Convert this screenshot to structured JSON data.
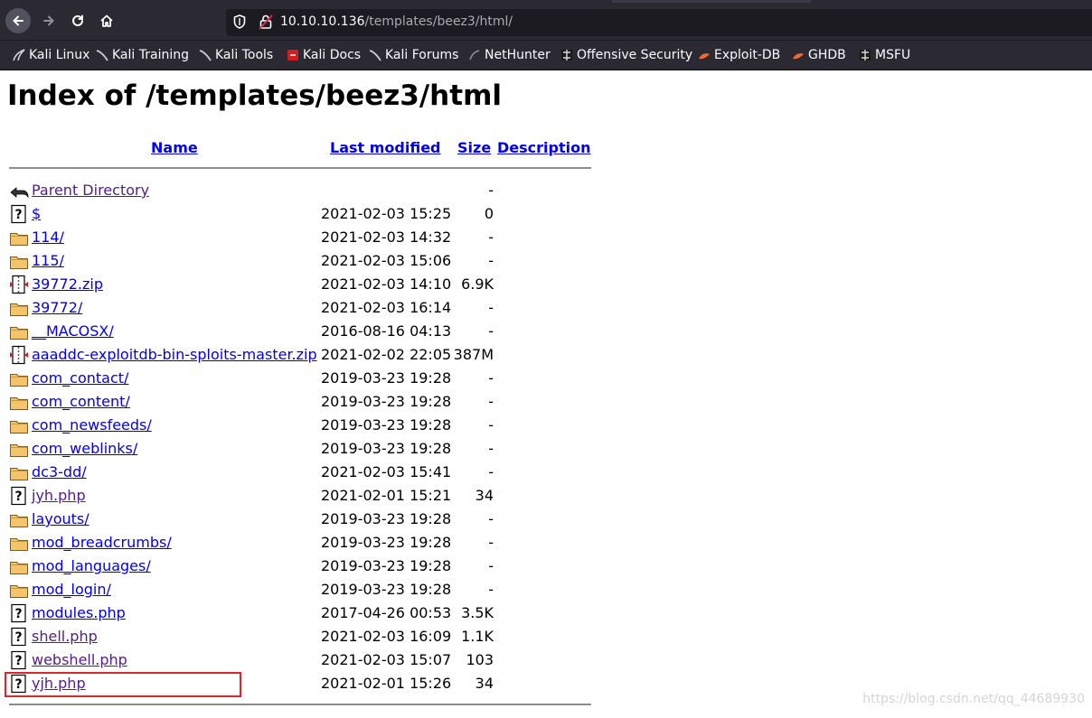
{
  "browser": {
    "url_host": "10.10.10.136",
    "url_path": "/templates/beez3/html/",
    "bookmarks": [
      {
        "label": "Kali Linux",
        "icon": "kali-dragon-icon"
      },
      {
        "label": "Kali Training",
        "icon": "kali-dragon-icon"
      },
      {
        "label": "Kali Tools",
        "icon": "kali-dragon-icon"
      },
      {
        "label": "Kali Docs",
        "icon": "kali-docs-icon"
      },
      {
        "label": "Kali Forums",
        "icon": "kali-dragon-icon"
      },
      {
        "label": "NetHunter",
        "icon": "nethunter-icon"
      },
      {
        "label": "Offensive Security",
        "icon": "offsec-icon"
      },
      {
        "label": "Exploit-DB",
        "icon": "exploitdb-icon"
      },
      {
        "label": "GHDB",
        "icon": "exploitdb-icon"
      },
      {
        "label": "MSFU",
        "icon": "offsec-icon"
      }
    ]
  },
  "page": {
    "title": "Index of /templates/beez3/html",
    "columns": {
      "name": "Name",
      "last_modified": "Last modified",
      "size": "Size",
      "description": "Description"
    },
    "entries": [
      {
        "name": "Parent Directory",
        "date": "",
        "size": "-",
        "icon": "parent-directory-icon",
        "visited": true
      },
      {
        "name": "$",
        "date": "2021-02-03 15:25",
        "size": "0",
        "icon": "unknown-file-icon",
        "visited": false
      },
      {
        "name": "114/",
        "date": "2021-02-03 14:32",
        "size": "-",
        "icon": "folder-icon",
        "visited": false
      },
      {
        "name": "115/",
        "date": "2021-02-03 15:06",
        "size": "-",
        "icon": "folder-icon",
        "visited": false
      },
      {
        "name": "39772.zip",
        "date": "2021-02-03 14:10",
        "size": "6.9K",
        "icon": "archive-icon",
        "visited": false
      },
      {
        "name": "39772/",
        "date": "2021-02-03 16:14",
        "size": "-",
        "icon": "folder-icon",
        "visited": false
      },
      {
        "name": "__MACOSX/",
        "date": "2016-08-16 04:13",
        "size": "-",
        "icon": "folder-icon",
        "visited": false
      },
      {
        "name": "aaaddc-exploitdb-bin-sploits-master.zip",
        "date": "2021-02-02 22:05",
        "size": "387M",
        "icon": "archive-icon",
        "visited": false
      },
      {
        "name": "com_contact/",
        "date": "2019-03-23 19:28",
        "size": "-",
        "icon": "folder-icon",
        "visited": false
      },
      {
        "name": "com_content/",
        "date": "2019-03-23 19:28",
        "size": "-",
        "icon": "folder-icon",
        "visited": false
      },
      {
        "name": "com_newsfeeds/",
        "date": "2019-03-23 19:28",
        "size": "-",
        "icon": "folder-icon",
        "visited": false
      },
      {
        "name": "com_weblinks/",
        "date": "2019-03-23 19:28",
        "size": "-",
        "icon": "folder-icon",
        "visited": false
      },
      {
        "name": "dc3-dd/",
        "date": "2021-02-03 15:41",
        "size": "-",
        "icon": "folder-icon",
        "visited": false
      },
      {
        "name": "jyh.php",
        "date": "2021-02-01 15:21",
        "size": "34",
        "icon": "unknown-file-icon",
        "visited": true
      },
      {
        "name": "layouts/",
        "date": "2019-03-23 19:28",
        "size": "-",
        "icon": "folder-icon",
        "visited": false
      },
      {
        "name": "mod_breadcrumbs/",
        "date": "2019-03-23 19:28",
        "size": "-",
        "icon": "folder-icon",
        "visited": false
      },
      {
        "name": "mod_languages/",
        "date": "2019-03-23 19:28",
        "size": "-",
        "icon": "folder-icon",
        "visited": false
      },
      {
        "name": "mod_login/",
        "date": "2019-03-23 19:28",
        "size": "-",
        "icon": "folder-icon",
        "visited": false
      },
      {
        "name": "modules.php",
        "date": "2017-04-26 00:53",
        "size": "3.5K",
        "icon": "unknown-file-icon",
        "visited": false
      },
      {
        "name": "shell.php",
        "date": "2021-02-03 16:09",
        "size": "1.1K",
        "icon": "unknown-file-icon",
        "visited": true
      },
      {
        "name": "webshell.php",
        "date": "2021-02-03 15:07",
        "size": "103",
        "icon": "unknown-file-icon",
        "visited": true
      },
      {
        "name": "yjh.php",
        "date": "2021-02-01 15:26",
        "size": "34",
        "icon": "unknown-file-icon",
        "visited": true
      }
    ],
    "watermark": "https://blog.csdn.net/qq_44689930"
  },
  "colors": {
    "link": "#0000ee",
    "visited": "#551a8b",
    "highlight_box": "#e0242b",
    "chrome_bg": "#2b2a33"
  }
}
